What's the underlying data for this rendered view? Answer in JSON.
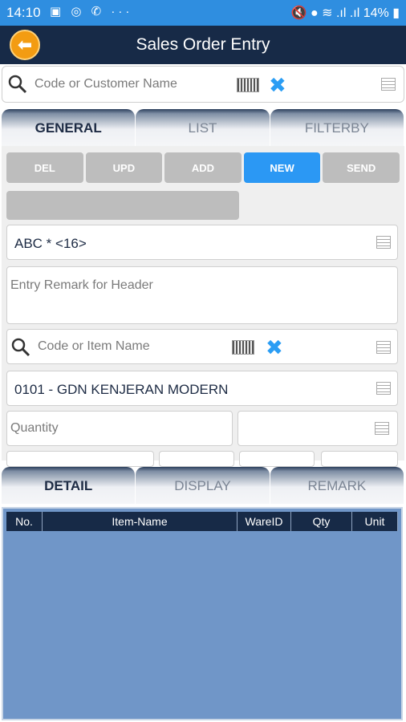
{
  "status": {
    "time": "14:10",
    "battery": "14%"
  },
  "header": {
    "title": "Sales Order Entry"
  },
  "customer_search": {
    "placeholder": "Code or Customer Name"
  },
  "top_tabs": [
    "GENERAL",
    "LIST",
    "FILTERBY"
  ],
  "actions": [
    "DEL",
    "UPD",
    "ADD",
    "NEW",
    "SEND"
  ],
  "form": {
    "customer_value": "ABC * <16>",
    "remark_placeholder": "Entry Remark for Header",
    "item_search_placeholder": "Code or Item Name",
    "warehouse_value": "0101 - GDN KENJERAN MODERN",
    "quantity_placeholder": "Quantity"
  },
  "bottom_tabs": [
    "DETAIL",
    "DISPLAY",
    "REMARK"
  ],
  "grid": {
    "columns": [
      "No.",
      "Item-Name",
      "WareID",
      "Qty",
      "Unit"
    ]
  },
  "colors": {
    "statusbar": "#2f8ee0",
    "titlebar": "#172a47",
    "accent": "#2b98f4",
    "back_button": "#f39c12",
    "grid_bg": "#7096c8"
  }
}
